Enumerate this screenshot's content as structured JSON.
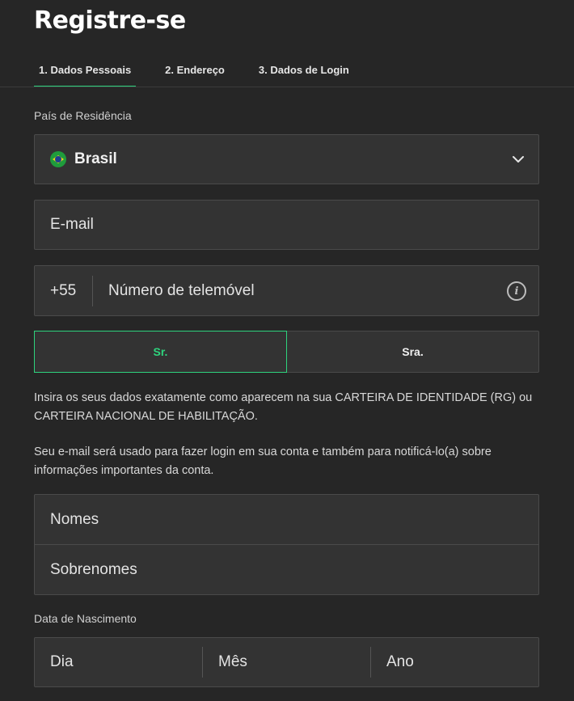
{
  "header": {
    "title": "Registre-se"
  },
  "tabs": [
    {
      "label": "1.  Dados Pessoais"
    },
    {
      "label": "2.  Endereço"
    },
    {
      "label": "3.  Dados de Login"
    }
  ],
  "country": {
    "label": "País de Residência",
    "value": "Brasil",
    "flag_icon": "brazil-flag-icon"
  },
  "email": {
    "placeholder": "E-mail"
  },
  "phone": {
    "prefix": "+55",
    "placeholder": "Número de telemóvel",
    "info_glyph": "i"
  },
  "gender": {
    "options": [
      "Sr.",
      "Sra."
    ],
    "selected": "Sr."
  },
  "info": {
    "id_notice": "Insira os seus dados exatamente como aparecem na sua CARTEIRA DE IDENTIDADE (RG) ou CARTEIRA NACIONAL DE HABILITAÇÃO.",
    "email_notice": "Seu e-mail será usado para fazer login em sua conta e também para notificá-lo(a) sobre informações importantes da conta."
  },
  "names": {
    "first_placeholder": "Nomes",
    "last_placeholder": "Sobrenomes"
  },
  "dob": {
    "label": "Data de Nascimento",
    "day": "Dia",
    "month": "Mês",
    "year": "Ano"
  },
  "colors": {
    "accent": "#2ed37d",
    "background": "#262626",
    "field": "#333333"
  }
}
